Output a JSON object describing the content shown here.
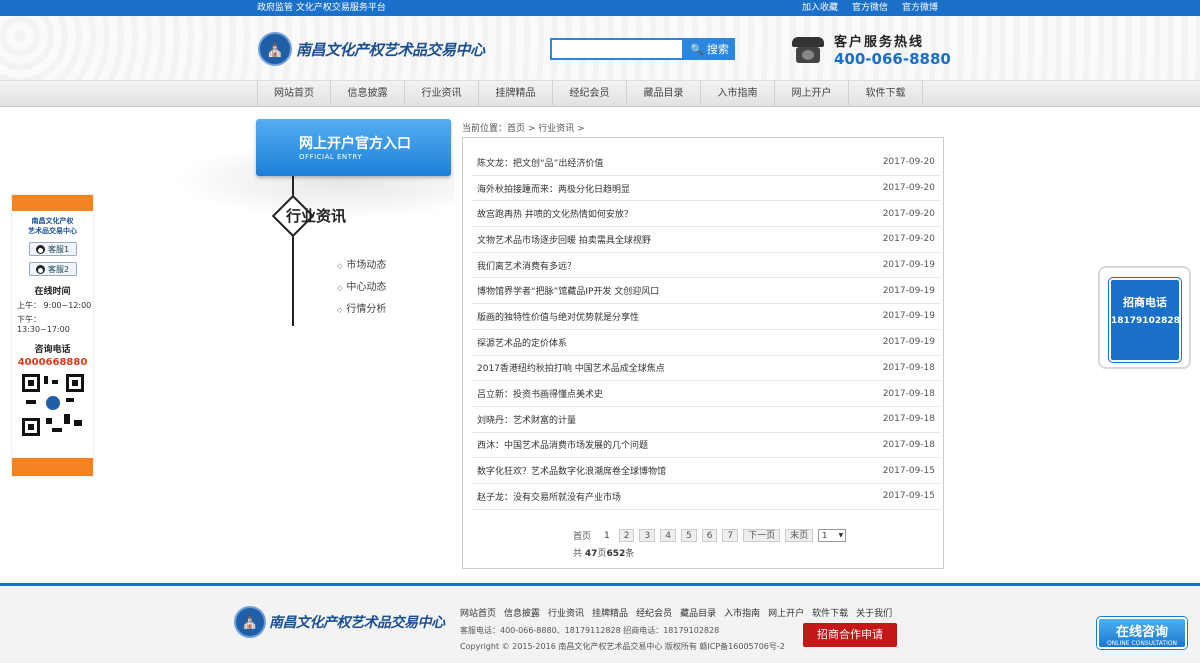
{
  "topbar": {
    "slogan": "政府监管 文化产权交易服务平台",
    "links": [
      "加入收藏",
      "官方微信",
      "官方微博"
    ]
  },
  "header": {
    "logo_text": "南昌文化产权艺术品交易中心",
    "search": {
      "placeholder": "",
      "button_label": "搜索"
    },
    "hotline": {
      "title": "客户服务热线",
      "number": "400-066-8880"
    }
  },
  "nav": {
    "items": [
      "网站首页",
      "信息披露",
      "行业资讯",
      "挂牌精品",
      "经纪会员",
      "藏品目录",
      "入市指南",
      "网上开户",
      "软件下载"
    ]
  },
  "float_left": {
    "brand_line1": "南昌文化产权",
    "brand_line2": "艺术品交易中心",
    "qq1": "客服1",
    "qq2": "客服2",
    "hours_title": "在线时间",
    "am": "上午： 9:00~12:00",
    "pm": "下午： 13:30~17:00",
    "phone_title": "咨询电话",
    "phone": "4000668880"
  },
  "sidebar": {
    "entry_title": "网上开户官方入口",
    "entry_subtitle": "OFFICIAL ENTRY",
    "category_title": "行业资讯",
    "subnav": [
      "市场动态",
      "中心动态",
      "行情分析"
    ]
  },
  "breadcrumb": "当前位置：首页 > 行业资讯 >",
  "articles": [
    {
      "title": "陈文龙：把文创“品”出经济价值",
      "date": "2017-09-20"
    },
    {
      "title": "海外秋拍接踵而来：两极分化日趋明显",
      "date": "2017-09-20"
    },
    {
      "title": "故宫跑再热 井喷的文化热情如何安放？",
      "date": "2017-09-20"
    },
    {
      "title": "文物艺术品市场逐步回暖 拍卖需具全球视野",
      "date": "2017-09-20"
    },
    {
      "title": "我们离艺术消费有多远？",
      "date": "2017-09-19"
    },
    {
      "title": "博物馆界学者“把脉”馆藏品IP开发 文创迎风口",
      "date": "2017-09-19"
    },
    {
      "title": "版画的独特性价值与绝对优势就是分享性",
      "date": "2017-09-19"
    },
    {
      "title": "探源艺术品的定价体系",
      "date": "2017-09-19"
    },
    {
      "title": "2017香港纽约秋拍打响 中国艺术品成全球焦点",
      "date": "2017-09-18"
    },
    {
      "title": "吕立新：投资书画得懂点美术史",
      "date": "2017-09-18"
    },
    {
      "title": "刘晓丹：艺术财富的计量",
      "date": "2017-09-18"
    },
    {
      "title": "西沐：中国艺术品消费市场发展的几个问题",
      "date": "2017-09-18"
    },
    {
      "title": "数字化狂欢？艺术品数字化浪潮席卷全球博物馆",
      "date": "2017-09-15"
    },
    {
      "title": "赵子龙：没有交易所就没有产业市场",
      "date": "2017-09-15"
    }
  ],
  "pager": {
    "first": "首页",
    "current": "1",
    "pages": [
      "2",
      "3",
      "4",
      "5",
      "6",
      "7"
    ],
    "next": "下一页",
    "last": "末页",
    "select_value": "1",
    "total_prefix": "共",
    "total_pages": "47",
    "total_mid": "页",
    "total_items": "652",
    "total_suffix": "条"
  },
  "float_right": {
    "title": "招商电话",
    "phone": "18179102828"
  },
  "footer": {
    "logo_text": "南昌文化产权艺术品交易中心",
    "links": [
      "网站首页",
      "信息披露",
      "行业资讯",
      "挂牌精品",
      "经纪会员",
      "藏品目录",
      "入市指南",
      "网上开户",
      "软件下载",
      "关于我们"
    ],
    "contact": "客服电话：400-066-8880、18179112828 招商电话：18179102828",
    "copyright": "Copyright © 2015-2016 南昌文化产权艺术品交易中心 版权所有 赣ICP备16005706号-2",
    "apply_button": "招商合作申请"
  },
  "consult": {
    "title": "在线咨询",
    "subtitle": "ONLINE CONSULTATION"
  },
  "colors": {
    "brand_blue": "#1a6fc9",
    "orange": "#f58220",
    "red": "#c41717"
  }
}
